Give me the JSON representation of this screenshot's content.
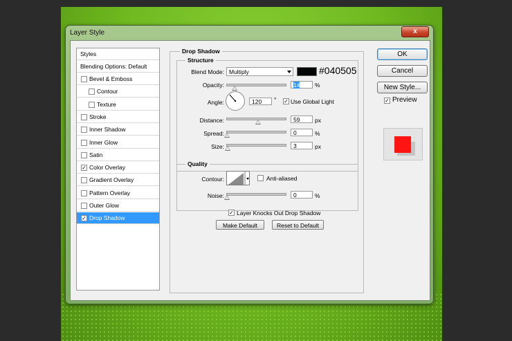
{
  "window": {
    "title": "Layer Style",
    "close_label": "x"
  },
  "styles_list": {
    "header": "Styles",
    "blending_options": "Blending Options: Default",
    "items": [
      {
        "label": "Bevel & Emboss",
        "checked": false,
        "sub": false
      },
      {
        "label": "Contour",
        "checked": false,
        "sub": true
      },
      {
        "label": "Texture",
        "checked": false,
        "sub": true
      },
      {
        "label": "Stroke",
        "checked": false,
        "sub": false
      },
      {
        "label": "Inner Shadow",
        "checked": false,
        "sub": false
      },
      {
        "label": "Inner Glow",
        "checked": false,
        "sub": false
      },
      {
        "label": "Satin",
        "checked": false,
        "sub": false
      },
      {
        "label": "Color Overlay",
        "checked": true,
        "sub": false
      },
      {
        "label": "Gradient Overlay",
        "checked": false,
        "sub": false
      },
      {
        "label": "Pattern Overlay",
        "checked": false,
        "sub": false
      },
      {
        "label": "Outer Glow",
        "checked": false,
        "sub": false
      },
      {
        "label": "Drop Shadow",
        "checked": true,
        "sub": false,
        "selected": true
      }
    ]
  },
  "drop_shadow": {
    "title": "Drop Shadow",
    "structure": {
      "title": "Structure",
      "blend_mode_label": "Blend Mode:",
      "blend_mode_value": "Multiply",
      "shadow_color": "#040505",
      "shadow_color_text": "#040505",
      "opacity_label": "Opacity:",
      "opacity_value": "14",
      "opacity_unit": "%",
      "angle_label": "Angle:",
      "angle_value": "120",
      "angle_unit": "°",
      "use_global_light_label": "Use Global Light",
      "use_global_light": true,
      "distance_label": "Distance:",
      "distance_value": "59",
      "distance_unit": "px",
      "spread_label": "Spread:",
      "spread_value": "0",
      "spread_unit": "%",
      "size_label": "Size:",
      "size_value": "3",
      "size_unit": "px"
    },
    "quality": {
      "title": "Quality",
      "contour_label": "Contour:",
      "anti_aliased_label": "Anti-aliased",
      "anti_aliased": false,
      "noise_label": "Noise:",
      "noise_value": "0",
      "noise_unit": "%"
    },
    "knocks_out_label": "Layer Knocks Out Drop Shadow",
    "knocks_out": true,
    "make_default_label": "Make Default",
    "reset_default_label": "Reset to Default"
  },
  "buttons": {
    "ok": "OK",
    "cancel": "Cancel",
    "new_style": "New Style...",
    "preview_label": "Preview",
    "preview_checked": true
  },
  "preview_colors": {
    "swatch": "#ff1414",
    "shadow": "#c4c4c4"
  }
}
